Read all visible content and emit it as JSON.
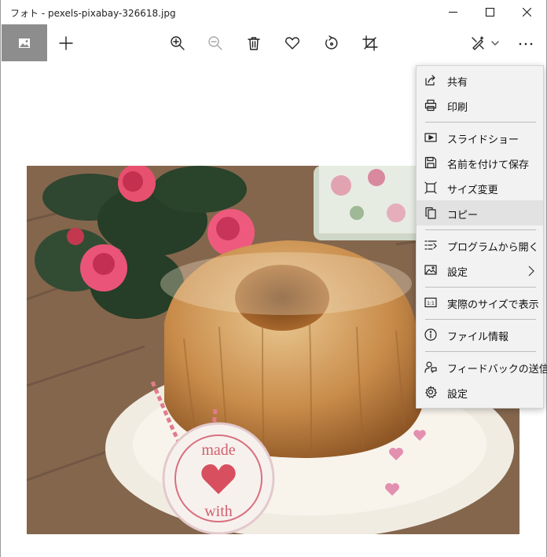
{
  "window": {
    "title": "フォト - pexels-pixabay-326618.jpg"
  },
  "menu": {
    "items": [
      {
        "label": "共有",
        "icon": "share-icon"
      },
      {
        "label": "印刷",
        "icon": "print-icon"
      },
      {
        "label": "スライドショー",
        "icon": "slideshow-icon"
      },
      {
        "label": "名前を付けて保存",
        "icon": "save-icon"
      },
      {
        "label": "サイズ変更",
        "icon": "resize-icon"
      },
      {
        "label": "コピー",
        "icon": "copy-icon"
      },
      {
        "label": "プログラムから開く",
        "icon": "open-with-icon"
      },
      {
        "label": "設定",
        "icon": "set-as-icon"
      },
      {
        "label": "実際のサイズで表示",
        "icon": "actual-size-icon"
      },
      {
        "label": "ファイル情報",
        "icon": "info-icon"
      },
      {
        "label": "フィードバックの送信",
        "icon": "feedback-icon"
      },
      {
        "label": "設定",
        "icon": "settings-gear-icon"
      }
    ]
  },
  "photo": {
    "stamp_text_top": "made",
    "stamp_text_bottom": "with"
  }
}
